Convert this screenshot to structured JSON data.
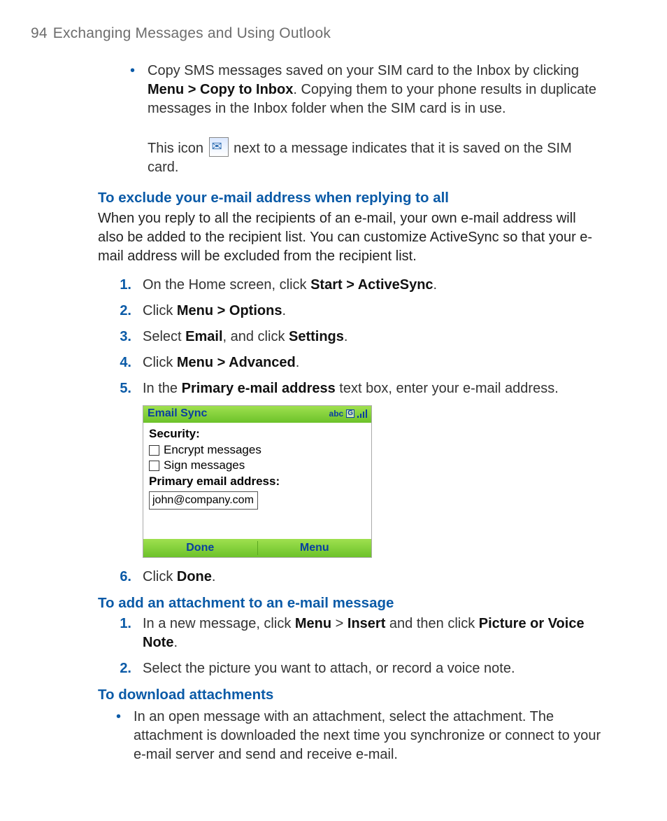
{
  "header": {
    "page_number": "94",
    "chapter_title": "Exchanging Messages and Using Outlook"
  },
  "bullet1": {
    "pre": "Copy SMS messages saved on your SIM card to the Inbox by clicking ",
    "bold1": "Menu > Copy to Inbox",
    "post": ". Copying them to your phone results in duplicate messages in the Inbox folder when the SIM card is in use."
  },
  "icon_line": {
    "pre": "This icon ",
    "icon_name": "sim-message-icon",
    "post": " next to a message indicates that it is saved on the SIM card."
  },
  "sec1": {
    "title": "To exclude your e-mail address when replying to all",
    "para": "When you reply to all the recipients of an e-mail, your own e-mail address will also be added to the recipient list. You can customize ActiveSync so that your e-mail address will be excluded from the recipient list.",
    "steps": [
      {
        "n": "1.",
        "pre": "On the Home screen, click ",
        "b": "Start > ActiveSync",
        "post": "."
      },
      {
        "n": "2.",
        "pre": "Click ",
        "b": "Menu > Options",
        "post": "."
      },
      {
        "n": "3.",
        "pre": "Select ",
        "b": "Email",
        "mid": ", and click ",
        "b2": "Settings",
        "post": "."
      },
      {
        "n": "4.",
        "pre": "Click ",
        "b": "Menu > Advanced",
        "post": "."
      },
      {
        "n": "5.",
        "pre": "In the ",
        "b": "Primary e-mail address",
        "post": " text box, enter your e-mail address."
      }
    ],
    "step6": {
      "n": "6.",
      "pre": "Click ",
      "b": "Done",
      "post": "."
    }
  },
  "phone": {
    "title": "Email Sync",
    "status_abc": "abc",
    "status_g": "G",
    "security_label": "Security:",
    "encrypt_label": "Encrypt messages",
    "sign_label": "Sign messages",
    "primary_label": "Primary email address:",
    "email_value": "john@company.com",
    "soft_left": "Done",
    "soft_right": "Menu"
  },
  "sec2": {
    "title": "To add an attachment to an e-mail message",
    "steps": [
      {
        "n": "1.",
        "pre": "In a new message, click ",
        "b": "Menu",
        "mid1": " > ",
        "b2": "Insert",
        "mid2": " and then click ",
        "b3": "Picture or Voice Note",
        "post": "."
      },
      {
        "n": "2.",
        "full": "Select the picture you want to attach, or record a voice note."
      }
    ]
  },
  "sec3": {
    "title": "To download attachments",
    "bullet": "In an open message with an attachment, select the attachment. The attachment is downloaded the next time you synchronize or connect to your e-mail server and send and receive e-mail."
  }
}
